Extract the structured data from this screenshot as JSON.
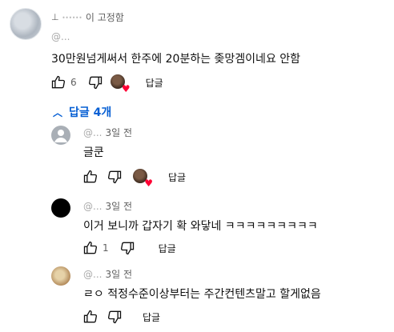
{
  "pinned_comment": {
    "pinned_label": "이 고정함",
    "author": "@...",
    "text": "30만원넘게써서 한주에 20분하는 좆망겜이네요 안함",
    "like_count": "6",
    "reply_label": "답글"
  },
  "replies_toggle": {
    "label": "답글 4개"
  },
  "replies": [
    {
      "author": "@...",
      "time": "3일 전",
      "text": "글쿤",
      "like_count": "",
      "reply_label": "답글",
      "avatar_color": "#a9afb6",
      "has_heart": true
    },
    {
      "author": "@...",
      "time": "3일 전",
      "text": "이거 보니까 갑자기 확 와닿네 ㅋㅋㅋㅋㅋㅋㅋㅋㅋ",
      "like_count": "1",
      "reply_label": "답글",
      "avatar_color": "#000000",
      "has_heart": false
    },
    {
      "author": "@...",
      "time": "3일 전",
      "text": "ㄹㅇ 적정수준이상부터는 주간컨텐츠말고 할게없음",
      "like_count": "",
      "reply_label": "답글",
      "avatar_color": "#c9a878",
      "has_heart": false
    }
  ],
  "colors": {
    "link_blue": "#065fd4",
    "heart_red": "#ff0033",
    "secondary_text": "#606060"
  },
  "icons": {
    "like": "thumb-up-icon",
    "dislike": "thumb-down-icon",
    "pin": "pin-icon",
    "toggle": "chevron-up-icon"
  }
}
